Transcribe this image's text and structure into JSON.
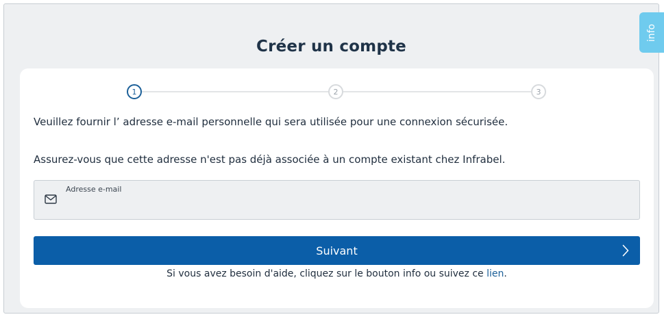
{
  "page": {
    "title": "Créer un compte",
    "info_tab": "info"
  },
  "stepper": {
    "current": 1,
    "steps": [
      "1",
      "2",
      "3"
    ]
  },
  "content": {
    "paragraph1": "Veuillez fournir l’ adresse e-mail personnelle qui sera utilisée pour une connexion sécurisée.",
    "paragraph2": "Assurez-vous que cette adresse n'est pas déjà associée à un compte existant chez Infrabel."
  },
  "email_field": {
    "label": "Adresse e-mail",
    "value": "",
    "icon": "envelope-icon"
  },
  "next_button": {
    "label": "Suivant",
    "icon": "chevron-right-icon"
  },
  "help": {
    "text": "Si vous avez besoin d'aide, cliquez sur le bouton info ou suivez ce ",
    "link": "lien",
    "suffix": "."
  },
  "colors": {
    "primary": "#0b5ea8",
    "info_tab": "#6fcbee",
    "background": "#eef0f2"
  }
}
